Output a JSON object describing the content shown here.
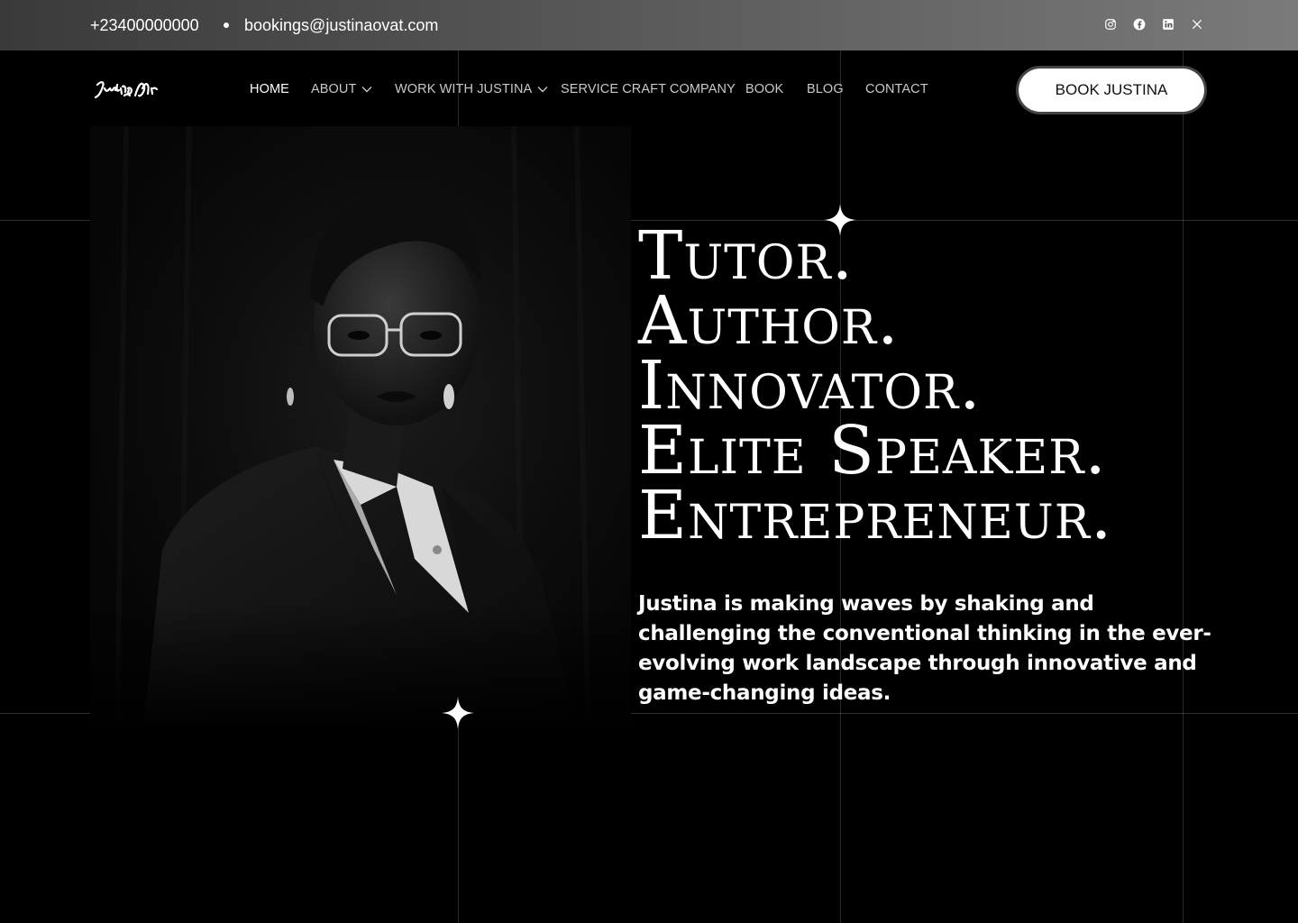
{
  "topbar": {
    "phone": "+23400000000",
    "email": "bookings@justinaovat.com",
    "socials": [
      "instagram-icon",
      "facebook-icon",
      "linkedin-icon",
      "x-icon"
    ]
  },
  "header": {
    "logo_text": "Justina OvAt",
    "nav": [
      {
        "label": "HOME",
        "active": true
      },
      {
        "label": "ABOUT",
        "dropdown": true
      },
      {
        "label": "WORK WITH JUSTINA",
        "dropdown": true
      },
      {
        "label": "SERVICE CRAFT COMPANY"
      },
      {
        "label": "BOOK"
      },
      {
        "label": "BLOG"
      },
      {
        "label": "CONTACT"
      }
    ],
    "cta": "BOOK JUSTINA"
  },
  "hero": {
    "lines": [
      "Tutor.",
      "Author.",
      "Innovator.",
      "Elite Speaker.",
      "Entrepreneur."
    ],
    "description": "Justina is making waves by shaking and challenging the conventional thinking in the ever-evolving work landscape through innovative and game-changing ideas."
  },
  "colors": {
    "background": "#000000",
    "text": "#ffffff",
    "nav_text": "#c9c9c9",
    "button_bg": "#ffffff"
  }
}
